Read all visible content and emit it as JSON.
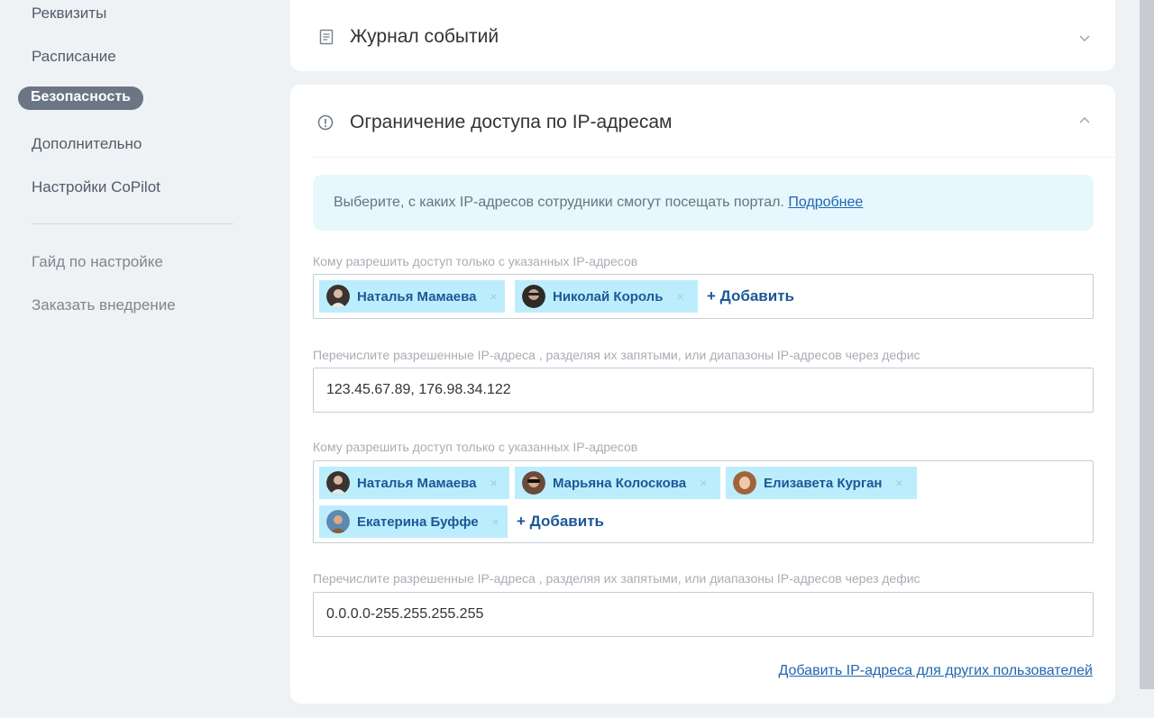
{
  "sidebar": {
    "items": [
      {
        "label": "Реквизиты"
      },
      {
        "label": "Расписание"
      },
      {
        "label": "Безопасность"
      },
      {
        "label": "Дополнительно"
      },
      {
        "label": "Настройки CoPilot"
      }
    ],
    "extra": [
      {
        "label": "Гайд по настройке"
      },
      {
        "label": "Заказать внедрение"
      }
    ]
  },
  "log_card": {
    "title": "Журнал событий",
    "icon": "document-icon"
  },
  "ip_card": {
    "title": "Ограничение доступа по IP-адресам",
    "icon": "warning-circle-icon",
    "info_text": "Выберите, с каких IP-адресов сотрудники смогут посещать портал.",
    "info_link": "Подробнее",
    "groups": [
      {
        "users_label": "Кому разрешить доступ только с указанных IP-адресов",
        "users": [
          "Наталья Мамаева",
          "Николай Король"
        ],
        "add_label": "+ Добавить",
        "ip_label": "Перечислите разрешенные IP-адреса , разделяя их запятыми, или диапазоны IP-адресов через дефис",
        "ip_value": "123.45.67.89, 176.98.34.122"
      },
      {
        "users_label": "Кому разрешить доступ только с указанных IP-адресов",
        "users": [
          "Наталья Мамаева",
          "Марьяна Колоскова",
          "Елизавета Курган",
          "Екатерина Буффе"
        ],
        "add_label": "+ Добавить",
        "ip_label": "Перечислите разрешенные IP-адреса , разделяя их запятыми, или диапазоны IP-адресов через дефис",
        "ip_value": "0.0.0.0-255.255.255.255"
      }
    ],
    "bottom_link": "Добавить IP-адреса для других пользователей"
  },
  "tag_remove_symbol": "×",
  "colors": {
    "accent": "#2067b0",
    "tag_bg": "#bcedfc",
    "active_nav": "#6b7583",
    "info_bg": "#e6f7fd"
  }
}
